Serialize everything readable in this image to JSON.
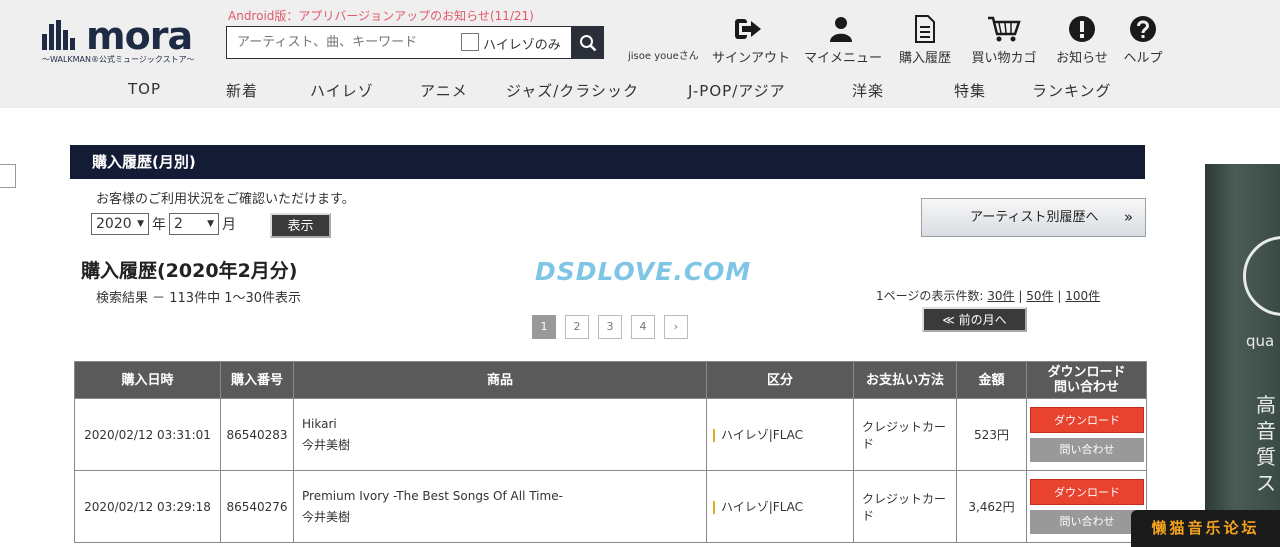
{
  "header": {
    "logo_text": "mora",
    "logo_sub": "〜WALKMAN®公式ミュージックストア〜",
    "notice": "Android版：アプリバージョンアップのお知らせ(11/21)",
    "search_placeholder": "アーティスト、曲、キーワード",
    "hires_only_label": "ハイレゾのみ",
    "user_name": "jisoe youeさん",
    "nav": {
      "signout": "サインアウト",
      "mymenu": "マイメニュー",
      "history": "購入履歴",
      "cart": "買い物カゴ",
      "news": "お知らせ",
      "help": "ヘルプ"
    },
    "categories": [
      "TOP",
      "新着",
      "ハイレゾ",
      "アニメ",
      "ジャズ/クラシック",
      "J-POP/アジア",
      "洋楽",
      "特集",
      "ランキング"
    ]
  },
  "main": {
    "section_title": "購入履歴(月別)",
    "description": "お客様のご利用状況をご確認いただけます。",
    "year_value": "2020",
    "year_unit": "年",
    "month_value": "2",
    "month_unit": "月",
    "show_button": "表示",
    "artist_history_button": "アーティスト別履歴へ",
    "artist_history_chevron": "»",
    "page_title": "購入履歴(2020年2月分)",
    "watermark": "DSDLOVE.COM",
    "result_text": "検索結果 － 113件中 1〜30件表示",
    "perpage_label": "1ページの表示件数:",
    "perpage_options": [
      "30件",
      "50件",
      "100件"
    ],
    "prev_month_button": "≪ 前の月へ",
    "pages": [
      "1",
      "2",
      "3",
      "4",
      "›"
    ],
    "active_page": "1"
  },
  "table": {
    "headers": {
      "date": "購入日時",
      "number": "購入番号",
      "product": "商品",
      "kind": "区分",
      "payment": "お支払い方法",
      "amount": "金額",
      "action_line1": "ダウンロード",
      "action_line2": "問い合わせ"
    },
    "download_label": "ダウンロード",
    "inquiry_label": "問い合わせ",
    "rows": [
      {
        "date": "2020/02/12 03:31:01",
        "number": "86540283",
        "title": "Hikari",
        "artist": "今井美樹",
        "kind": "ハイレゾ|FLAC",
        "payment": "クレジットカード",
        "amount": "523円"
      },
      {
        "date": "2020/02/12 03:29:18",
        "number": "86540276",
        "title": "Premium Ivory -The Best Songs Of All Time-",
        "artist": "今井美樹",
        "kind": "ハイレゾ|FLAC",
        "payment": "クレジットカード",
        "amount": "3,462円"
      }
    ]
  },
  "ad": {
    "text1": "qua",
    "text2": "高音質ス"
  },
  "forum_badge": "懒猫音乐论坛",
  "colors": {
    "header_bg": "#efefef",
    "section_bar": "#141b34",
    "notice": "#e05a6b",
    "download": "#e8432f",
    "table_header": "#5a5a5a"
  }
}
